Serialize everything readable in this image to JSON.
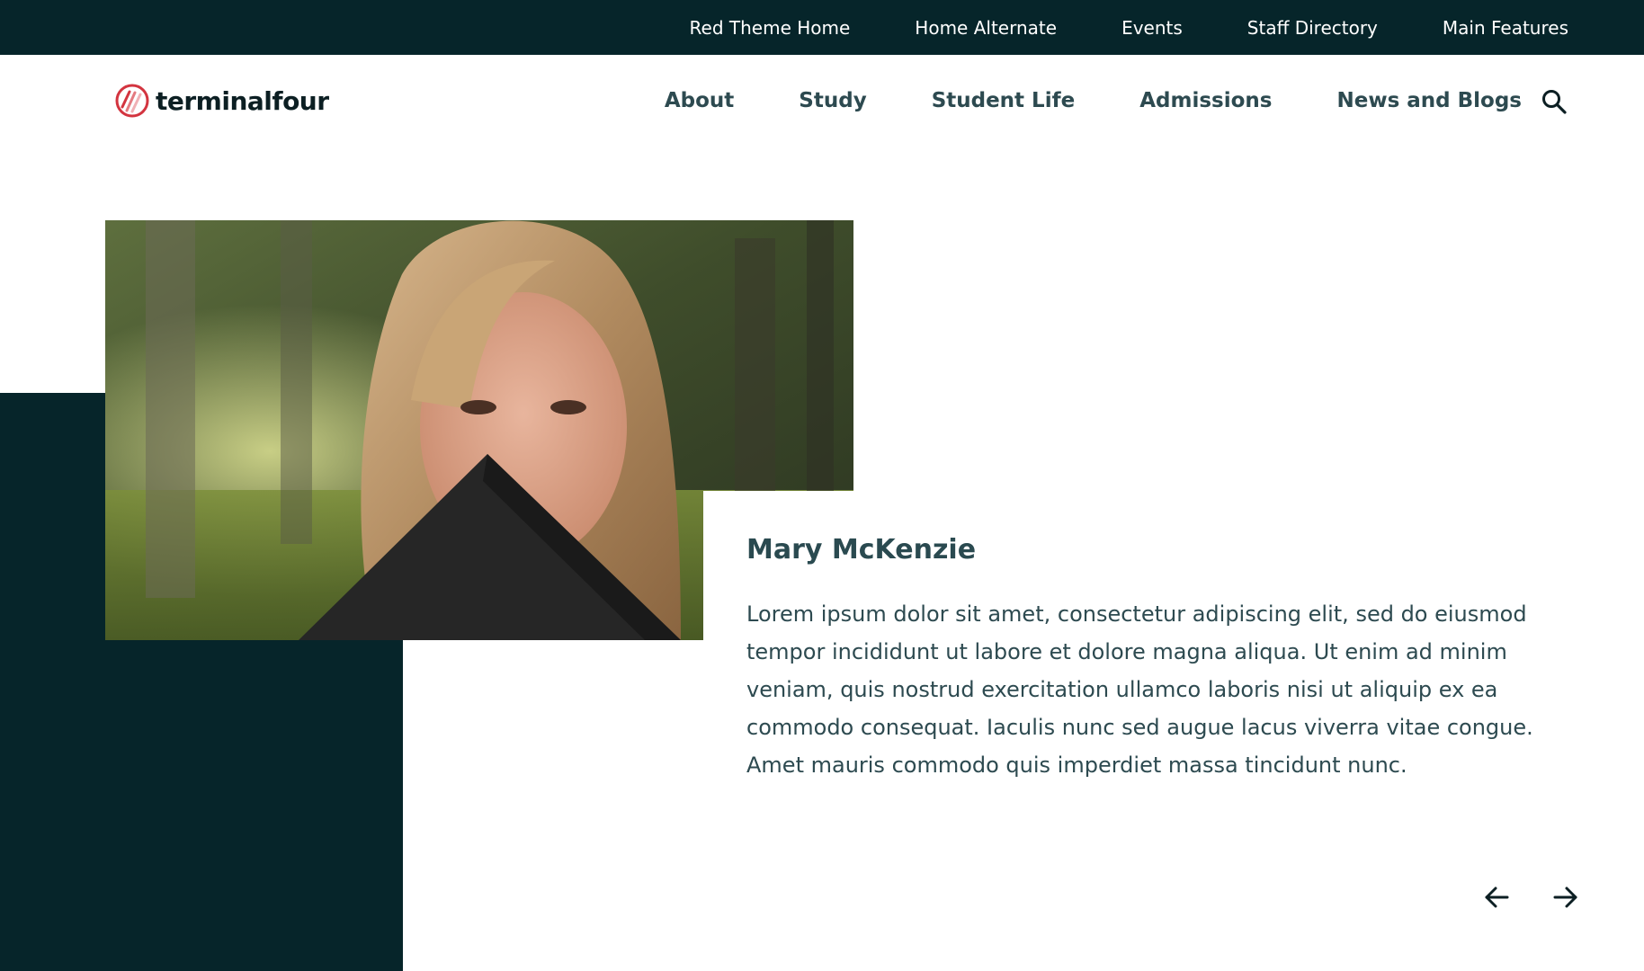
{
  "utility_nav": {
    "items": [
      {
        "label": "Red Theme Home"
      },
      {
        "label": "Home Alternate"
      },
      {
        "label": "Events"
      },
      {
        "label": "Staff Directory"
      },
      {
        "label": "Main Features"
      }
    ]
  },
  "header": {
    "logo_text": "terminalfour",
    "nav": [
      {
        "label": "About"
      },
      {
        "label": "Study"
      },
      {
        "label": "Student Life"
      },
      {
        "label": "Admissions"
      },
      {
        "label": "News and Blogs"
      }
    ],
    "search_icon": "search-icon"
  },
  "testimonial": {
    "name": "Mary McKenzie",
    "quote": "Lorem ipsum dolor sit amet, consectetur adipiscing elit, sed do eiusmod tempor incididunt ut labore et dolore magna aliqua. Ut enim ad minim veniam, quis nostrud exercitation ullamco laboris nisi ut aliquip ex ea commodo consequat. Iaculis nunc sed augue lacus viverra vitae congue. Amet mauris commodo quis imperdiet massa tincidunt nunc.",
    "prev_icon": "arrow-left-icon",
    "next_icon": "arrow-right-icon"
  },
  "colors": {
    "dark_teal": "#06252a",
    "text": "#2d4a50",
    "logo_red": "#d3343f"
  }
}
